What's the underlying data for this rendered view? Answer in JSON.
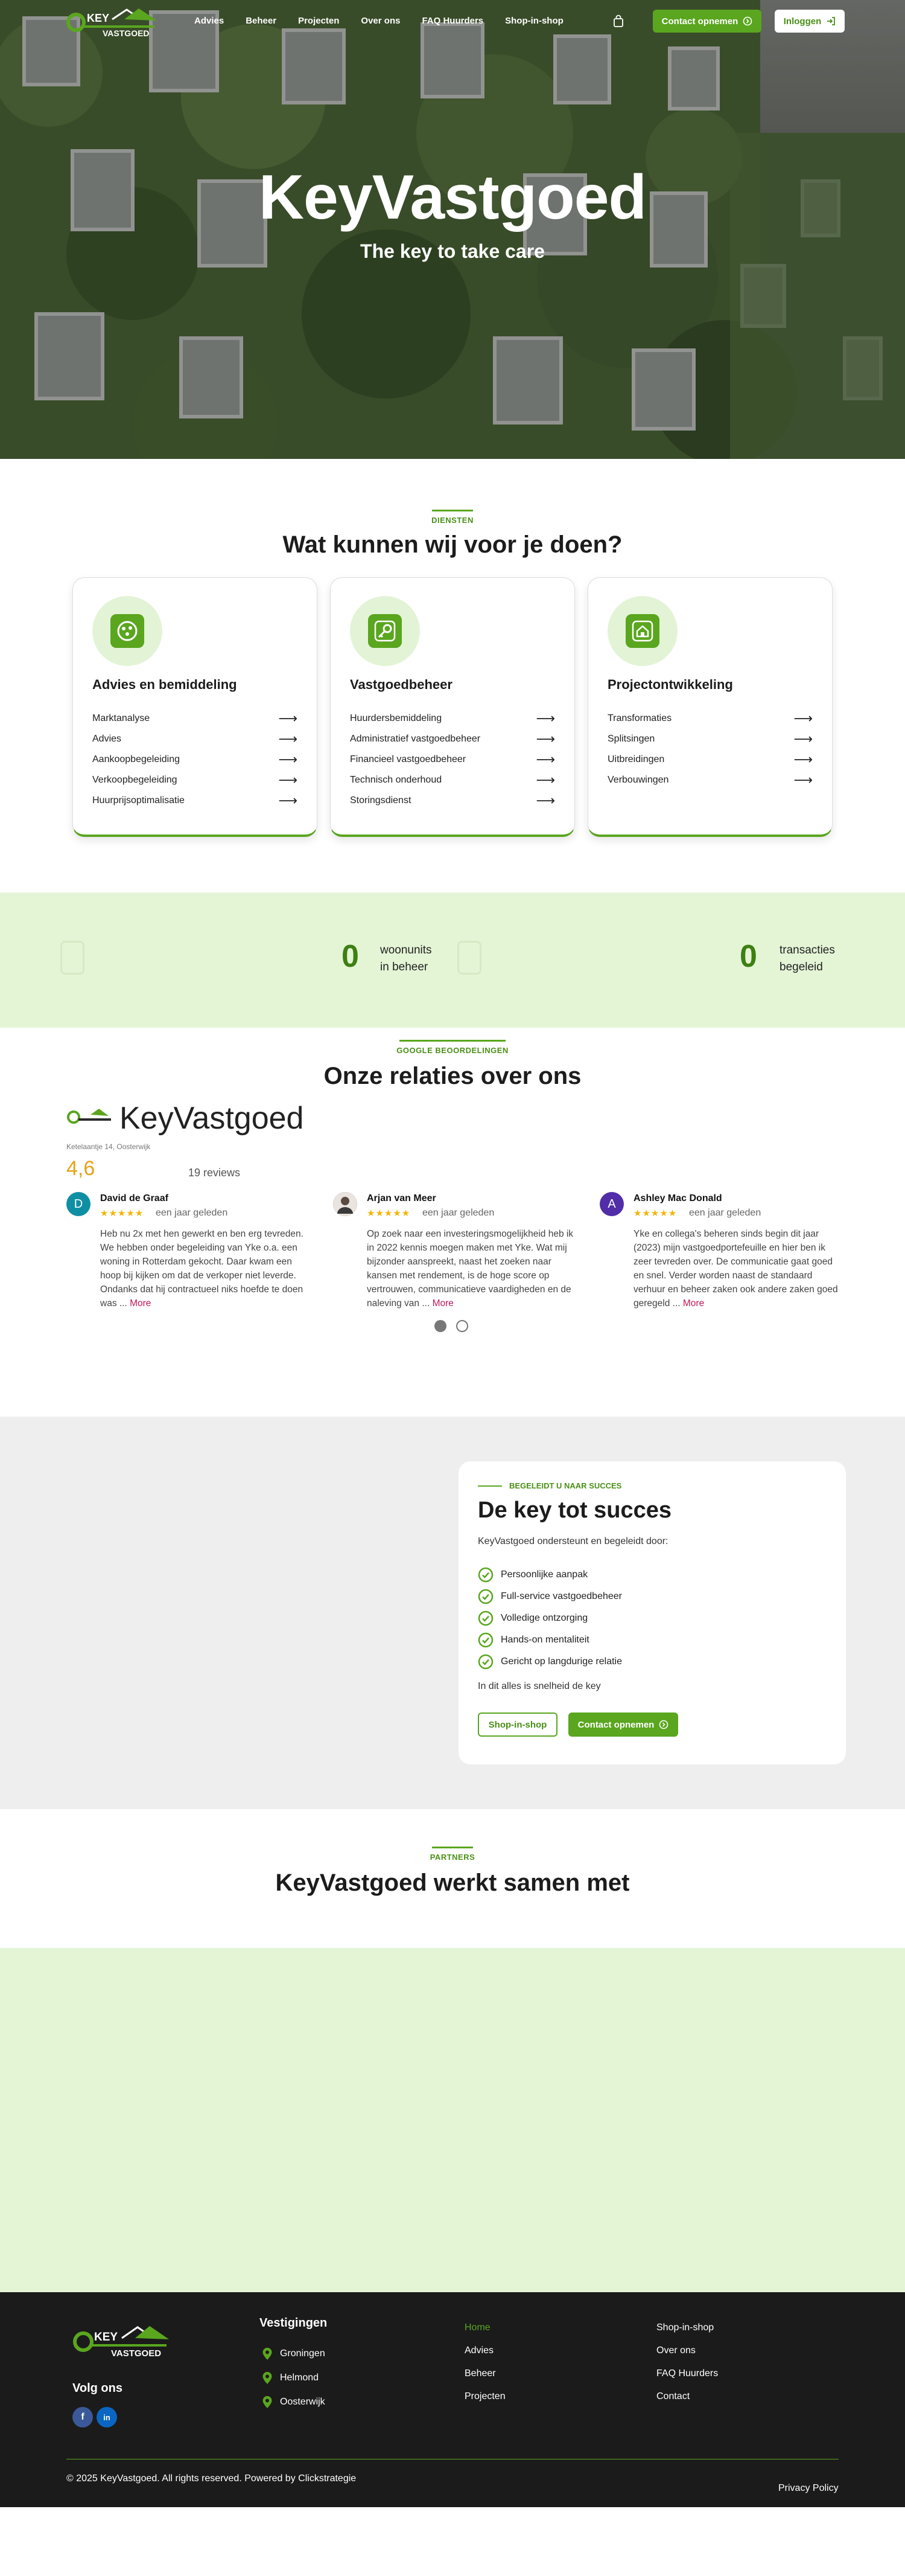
{
  "nav": {
    "logo_top": "KEY",
    "logo_bottom": "VASTGOED",
    "links": [
      "Advies",
      "Beheer",
      "Projecten",
      "Over ons",
      "FAQ Huurders",
      "Shop-in-shop"
    ],
    "contact_label": "Contact opnemen",
    "login_label": "Inloggen"
  },
  "hero": {
    "title": "KeyVastgoed",
    "subtitle": "The key to take care"
  },
  "services": {
    "eyebrow": "DIENSTEN",
    "title": "Wat kunnen wij voor je doen?",
    "cards": [
      {
        "title": "Advies en bemiddeling",
        "icon": "chat-icon",
        "items": [
          "Marktanalyse",
          "Advies",
          "Aankoopbegeleiding",
          "Verkoopbegeleiding",
          "Huurprijsoptimalisatie"
        ]
      },
      {
        "title": "Vastgoedbeheer",
        "icon": "key-icon",
        "items": [
          "Huurdersbemiddeling",
          "Administratief vastgoedbeheer",
          "Financieel vastgoedbeheer",
          "Technisch onderhoud",
          "Storingsdienst"
        ]
      },
      {
        "title": "Projectontwikkeling",
        "icon": "house-icon",
        "items": [
          "Transformaties",
          "Splitsingen",
          "Uitbreidingen",
          "Verbouwingen"
        ]
      }
    ]
  },
  "stats": [
    {
      "value": "0",
      "label_line1": "woonunits",
      "label_line2": "in beheer"
    },
    {
      "value": "0",
      "label_line1": "transacties",
      "label_line2": "begeleid"
    }
  ],
  "reviews": {
    "eyebrow": "GOOGLE BEOORDELINGEN",
    "title": "Onze relaties over ons",
    "business_name": "KeyVastgoed",
    "address": "Ketelaantje 14, Oosterwijk",
    "rating": "4,6",
    "count_text": "19 reviews",
    "more_label": "More",
    "items": [
      {
        "author": "David de Graaf",
        "initial": "D",
        "avatar_color": "#0f8fa3",
        "stars": "★★★★★",
        "time": "een jaar geleden",
        "text": "Heb nu 2x met hen gewerkt en ben erg tevreden. We hebben onder begeleiding van Yke o.a. een woning in Rotterdam gekocht. Daar kwam een hoop bij kijken om dat de verkoper niet leverde. Ondanks dat hij contractueel niks hoefde te doen was ..."
      },
      {
        "author": "Arjan van Meer",
        "initial": "",
        "avatar_color": "#5a4a42",
        "stars": "★★★★★",
        "time": "een jaar geleden",
        "text": "Op zoek naar een investeringsmogelijkheid heb ik in 2022 kennis moegen maken met Yke. Wat mij bijzonder aanspreekt, naast het zoeken naar kansen met rendement, is de hoge score op vertrouwen, communicatieve vaardigheden en de naleving van ..."
      },
      {
        "author": "Ashley Mac Donald",
        "initial": "A",
        "avatar_color": "#512da8",
        "stars": "★★★★★",
        "time": "een jaar geleden",
        "text": "Yke en collega's beheren sinds begin dit jaar (2023) mijn vastgoedportefeuille en hier ben ik zeer tevreden over. De communicatie gaat goed en snel. Verder worden naast de standaard verhuur en beheer zaken ook andere zaken goed geregeld ..."
      }
    ]
  },
  "success": {
    "eyebrow": "BEGELEIDT U NAAR SUCCES",
    "title": "De key tot succes",
    "intro": "KeyVastgoed ondersteunt en begeleidt door:",
    "items": [
      "Persoonlijke aanpak",
      "Full-service vastgoedbeheer",
      "Volledige ontzorging",
      "Hands-on mentaliteit",
      "Gericht op langdurige relatie"
    ],
    "outro": "In dit alles is snelheid de key",
    "shop_label": "Shop-in-shop",
    "contact_label": "Contact opnemen"
  },
  "partners": {
    "eyebrow": "PARTNERS",
    "title": "KeyVastgoed werkt samen met"
  },
  "footer": {
    "logo_top": "KEY",
    "logo_bottom": "VASTGOED",
    "follow": "Volg ons",
    "locations_title": "Vestigingen",
    "locations": [
      "Groningen",
      "Helmond",
      "Oosterwijk"
    ],
    "col1": [
      "Home",
      "Advies",
      "Beheer",
      "Projecten"
    ],
    "col2": [
      "Shop-in-shop",
      "Over ons",
      "FAQ Huurders",
      "Contact"
    ],
    "copyright": "© 2025 KeyVastgoed. All rights reserved. Powered by Clickstrategie",
    "privacy": "Privacy Policy",
    "facebook": "f",
    "linkedin": "in"
  },
  "colors": {
    "brand_green": "#5aa61f",
    "dark_green": "#3e7f12",
    "light_green_bg": "#e4f5d6",
    "footer_bg": "#1b1b1b",
    "star": "#f5b400"
  }
}
